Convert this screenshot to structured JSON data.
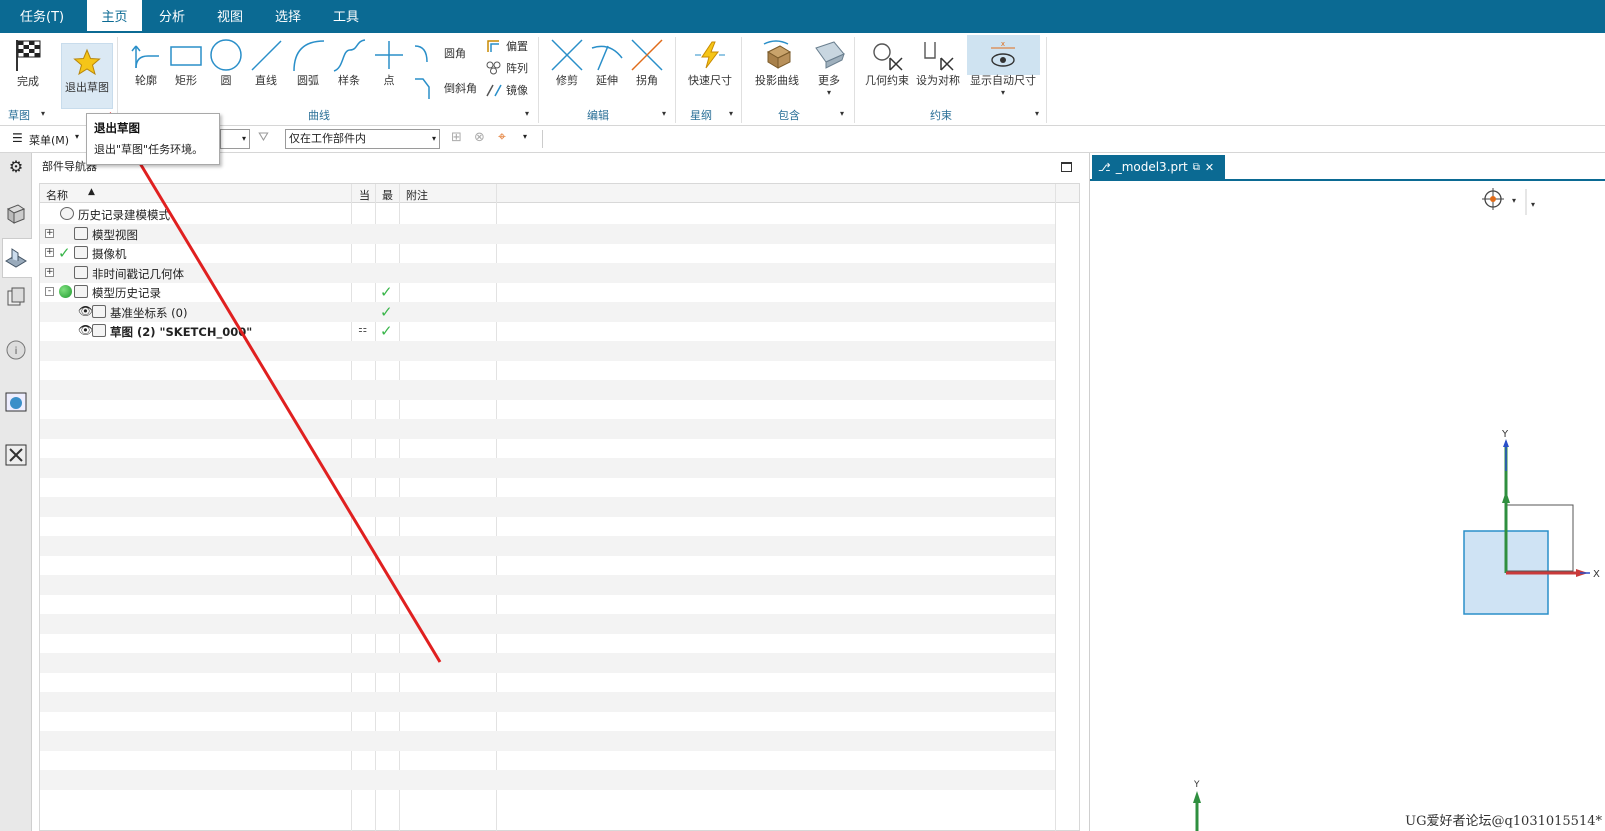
{
  "menubar": {
    "tabs": [
      "任务(T)",
      "主页",
      "分析",
      "视图",
      "选择",
      "工具"
    ],
    "active": "主页"
  },
  "ribbon": {
    "finish_label": "完成",
    "exit_sketch_label": "退出草图",
    "curve_buttons": [
      "轮廓",
      "矩形",
      "圆",
      "直线",
      "圆弧",
      "样条",
      "点"
    ],
    "fillet_label": "圆角",
    "chamfer_label": "倒斜角",
    "offset_label": "偏置",
    "pattern_label": "阵列",
    "mirror_label": "镜像",
    "trim_label": "修剪",
    "extend_label": "延伸",
    "corner_label": "拐角",
    "rapid_dim_label": "快速尺寸",
    "project_curve_label": "投影曲线",
    "more_label": "更多",
    "geo_constraint_label": "几何约束",
    "set_symmetric_label": "设为对称",
    "show_auto_dim_label": "显示自动尺寸",
    "groups": {
      "sketch": "草图",
      "curve": "曲线",
      "edit": "编辑",
      "dimension": "星纲",
      "include": "包含",
      "constraint": "约束"
    }
  },
  "toolbar": {
    "menu_label": "菜单(M)",
    "scope_value": "仅在工作部件内"
  },
  "tooltip": {
    "title": "退出草图",
    "desc": "退出\"草图\"任务环境。"
  },
  "navigator": {
    "title": "部件导航器",
    "col_name": "名称",
    "col_current": "当",
    "col_latest": "最",
    "col_note": "附注",
    "rows": [
      {
        "label": "历史记录建模模式"
      },
      {
        "label": "模型视图"
      },
      {
        "label": "摄像机"
      },
      {
        "label": "非时间戳记几何体"
      },
      {
        "label": "模型历史记录"
      },
      {
        "label": "基准坐标系 (0)"
      },
      {
        "label": "草图 (2) \"SKETCH_000\""
      }
    ]
  },
  "viewport": {
    "tab_label": "_model3.prt",
    "axis_x": "X",
    "axis_y": "Y"
  },
  "watermark": "UG爱好者论坛@q1031015514*",
  "colors": {
    "menubar": "#0b6a93",
    "accent": "#2a6f97",
    "check": "#39b54a",
    "annotation_arrow": "#e02020"
  }
}
